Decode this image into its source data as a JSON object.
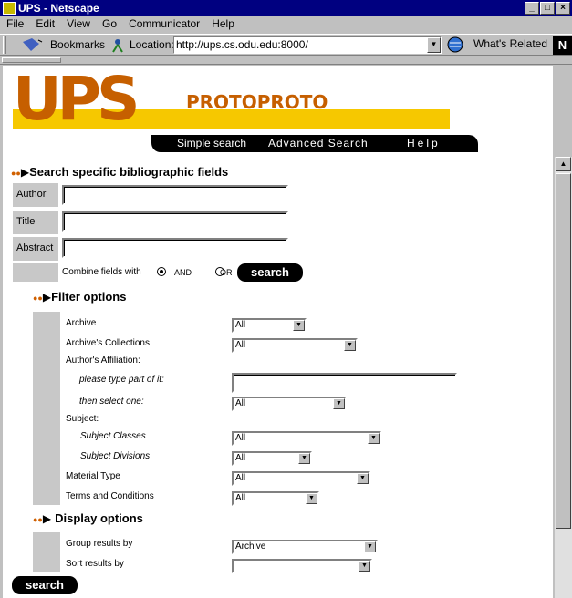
{
  "window": {
    "title": "UPS - Netscape"
  },
  "menu": [
    "File",
    "Edit",
    "View",
    "Go",
    "Communicator",
    "Help"
  ],
  "toolbar": {
    "bookmarks_label": "Bookmarks",
    "location_label": "Location:",
    "url": "http://ups.cs.odu.edu:8000/",
    "whats_related": "What's Related"
  },
  "logo": {
    "main": "UPS",
    "sub": "PROTOPROTO"
  },
  "nav": {
    "simple": "Simple search",
    "advanced": "Advanced Search",
    "help": "Help"
  },
  "search": {
    "heading": "Search specific bibliographic fields",
    "fields": [
      {
        "label": "Author",
        "value": ""
      },
      {
        "label": "Title",
        "value": ""
      },
      {
        "label": "Abstract",
        "value": ""
      }
    ],
    "combine_label": "Combine fields with",
    "and_label": "AND",
    "or_label": "OR",
    "combine_selected": "AND",
    "button": "search"
  },
  "filter": {
    "heading": "Filter options",
    "archive_label": "Archive",
    "archive_value": "All",
    "collections_label": "Archive's Collections",
    "collections_value": "All",
    "affiliation_label": "Author's Affiliation:",
    "type_part_label": "please type part of it:",
    "type_part_value": "",
    "select_one_label": "then select one:",
    "select_one_value": "All",
    "subject_label": "Subject:",
    "subject_classes_label": "Subject Classes",
    "subject_classes_value": "All",
    "subject_divisions_label": "Subject Divisions",
    "subject_divisions_value": "All",
    "material_label": "Material Type",
    "material_value": "All",
    "terms_label": "Terms and Conditions",
    "terms_value": "All"
  },
  "display": {
    "heading": "Display options",
    "group_label": "Group results by",
    "group_value": "Archive",
    "sort_label": "Sort results by",
    "sort_value": ""
  },
  "bottom_button": "search"
}
